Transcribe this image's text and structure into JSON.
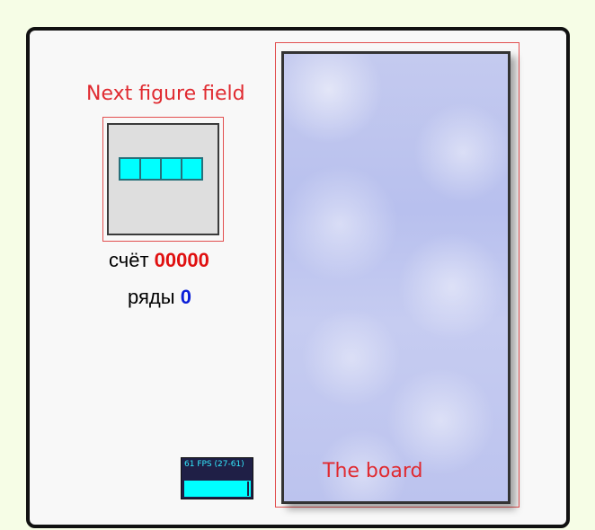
{
  "annotations": {
    "next_figure_field": "Next figure field",
    "the_board": "The board"
  },
  "score": {
    "label": "счёт",
    "value": "00000"
  },
  "lines": {
    "label": "ряды",
    "value": "0"
  },
  "fps_meter": {
    "text": "61 FPS (27-61)"
  },
  "next_piece": {
    "shape": "I",
    "cells": 4,
    "color": "#00ffff"
  },
  "colors": {
    "annotation": "#e02a30",
    "score_value": "#e01010",
    "lines_value": "#0a1ed8",
    "background": "#f6fde6"
  }
}
